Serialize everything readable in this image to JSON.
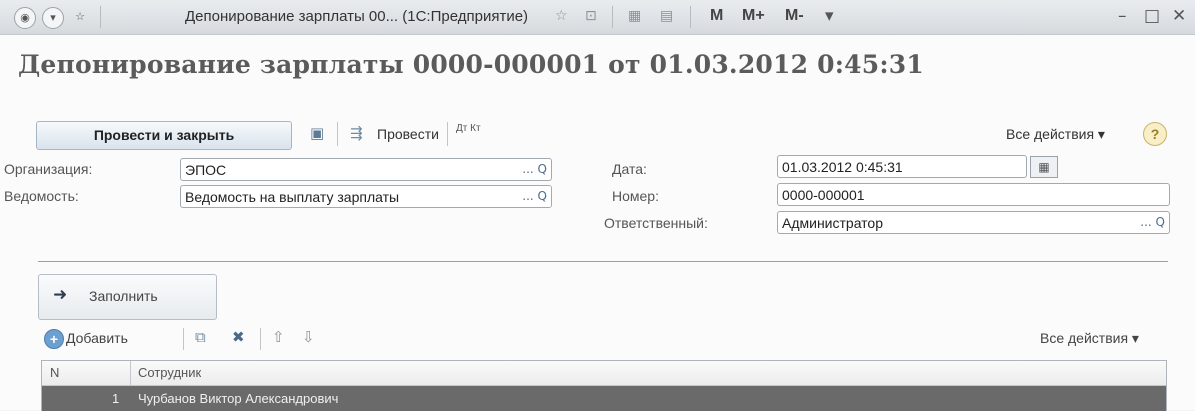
{
  "window": {
    "title": "Депонирование зарплаты 00... (1С:Предприятие)",
    "memory_buttons": [
      "M",
      "M+",
      "M-"
    ]
  },
  "document": {
    "title": "Депонирование зарплаты 0000-000001 от 01.03.2012 0:45:31"
  },
  "toolbar": {
    "post_and_close_label": "Провести и закрыть",
    "post_label": "Провести",
    "dt_kt_label": "Дт Кт",
    "all_actions_label": "Все действия ▾",
    "help_label": "?"
  },
  "form": {
    "organization_label": "Организация:",
    "organization_value": "ЭПОС",
    "statement_label": "Ведомость:",
    "statement_value": "Ведомость на выплату зарплаты",
    "date_label": "Дата:",
    "date_value": "01.03.2012  0:45:31",
    "number_label": "Номер:",
    "number_value": "0000-000001",
    "responsible_label": "Ответственный:",
    "responsible_value": "Администратор",
    "pick_label": "...",
    "search_label": "Q"
  },
  "fill_button": {
    "label": "Заполнить"
  },
  "table_bar": {
    "add_label": "Добавить",
    "all_actions_label": "Все действия ▾"
  },
  "table": {
    "columns": [
      "N",
      "Сотрудник"
    ],
    "rows": [
      {
        "n": "1",
        "employee": "Чурбанов Виктор Александрович"
      }
    ]
  },
  "icons": {
    "calendar": "calendar-icon",
    "save": "save-icon",
    "post": "post-icon",
    "refresh": "refresh-icon",
    "copy": "copy-icon",
    "delete": "delete-icon",
    "move_up": "move-up-icon",
    "move_down": "move-down-icon"
  },
  "colors": {
    "selected_row": "#6a6a6a",
    "title_text": "#5b5b5b"
  }
}
